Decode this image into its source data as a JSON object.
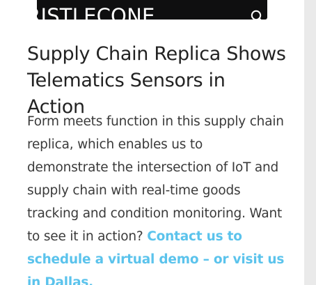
{
  "header": {
    "logo_text": "BRISTLECONE",
    "icons": {
      "search": "search-icon",
      "menu": "hamburger-menu-icon"
    }
  },
  "article": {
    "title": "Supply Chain Replica Shows Telematics Sensors in Action",
    "body_text": "Form meets function in this supply chain replica, which enables us to demonstrate the intersection of IoT and supply chain with real-time goods tracking and condition monitoring. Want to see it in action? ",
    "cta_link_text": "Contact us to schedule a virtual demo – or visit us in Dallas."
  },
  "colors": {
    "link": "#5bc3ec",
    "title": "#222222",
    "body": "#3a3a3a",
    "header_strip": "#0f0f10",
    "page_background": "#eaeaea"
  }
}
